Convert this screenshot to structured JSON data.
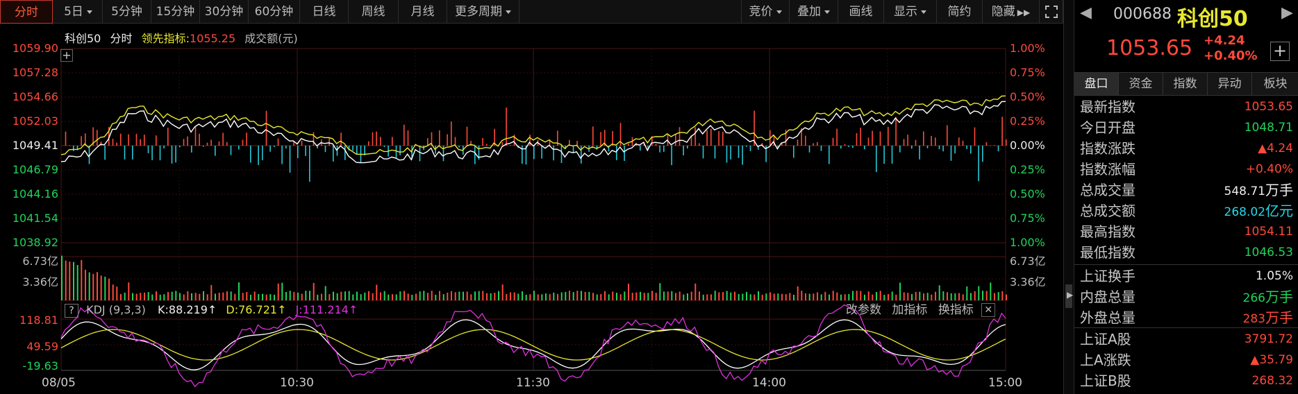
{
  "toolbar": {
    "periods": [
      "分时",
      "5日",
      "5分钟",
      "15分钟",
      "30分钟",
      "60分钟",
      "日线",
      "周线",
      "月线",
      "更多周期"
    ],
    "active_period": "分时",
    "right_buttons": [
      "竞价",
      "叠加",
      "画线",
      "显示",
      "简约",
      "隐藏"
    ]
  },
  "main_legend": {
    "name": "科创50",
    "mode": "分时",
    "leader_label": "领先指标:",
    "leader_value": "1055.25",
    "volume_label": "成交额(元)"
  },
  "price_axis": {
    "left": [
      "1059.90",
      "1057.28",
      "1054.66",
      "1052.03",
      "1049.41",
      "1046.79",
      "1044.16",
      "1041.54",
      "1038.92"
    ],
    "right": [
      "1.00%",
      "0.75%",
      "0.50%",
      "0.25%",
      "0.00%",
      "0.25%",
      "0.50%",
      "0.75%",
      "1.00%"
    ]
  },
  "volume_axis": {
    "left": [
      "6.73亿",
      "3.36亿"
    ],
    "right": [
      "6.73亿",
      "3.36亿"
    ]
  },
  "kdj": {
    "question": "?",
    "title": "KDJ (9,3,3)",
    "k_label": "K:88.219↑",
    "d_label": "D:76.721↑",
    "j_label": "J:111.214↑",
    "axis": [
      "118.81",
      "49.59",
      "-19.63"
    ],
    "actions": [
      "改参数",
      "加指标",
      "换指标"
    ]
  },
  "time_axis": [
    "08/05",
    "10:30",
    "11:30",
    "14:00",
    "15:00"
  ],
  "quote": {
    "code": "000688",
    "name": "科创50",
    "price": "1053.65",
    "change": "+4.24",
    "change_pct": "+0.40%"
  },
  "panel_tabs": [
    "盘口",
    "资金",
    "指数",
    "异动",
    "板块"
  ],
  "panel_active": "盘口",
  "stats": [
    {
      "k": "最新指数",
      "v": "1053.65",
      "c": "red",
      "u": ""
    },
    {
      "k": "今日开盘",
      "v": "1048.71",
      "c": "green",
      "u": ""
    },
    {
      "k": "指数涨跌",
      "v": "▲4.24",
      "c": "red",
      "u": ""
    },
    {
      "k": "指数涨幅",
      "v": "+0.40%",
      "c": "red",
      "u": ""
    },
    {
      "k": "总成交量",
      "v": "548.71",
      "c": "white",
      "u": "万手"
    },
    {
      "k": "总成交额",
      "v": "268.02",
      "c": "cyan",
      "u": "亿元"
    },
    {
      "k": "最高指数",
      "v": "1054.11",
      "c": "red",
      "u": ""
    },
    {
      "k": "最低指数",
      "v": "1046.53",
      "c": "green",
      "u": ""
    },
    {
      "k": "上证换手",
      "v": "1.05%",
      "c": "white",
      "u": ""
    },
    {
      "k": "内盘总量",
      "v": "266",
      "c": "green",
      "u": "万手"
    },
    {
      "k": "外盘总量",
      "v": "283",
      "c": "red",
      "u": "万手"
    },
    {
      "k": "上证A股",
      "v": "3791.72",
      "c": "red",
      "u": ""
    },
    {
      "k": "上A涨跌",
      "v": "▲35.79",
      "c": "red",
      "u": ""
    },
    {
      "k": "上证B股",
      "v": "268.32",
      "c": "red",
      "u": ""
    }
  ],
  "colors": {
    "up": "#ff4a3a",
    "down": "#21d45a",
    "index_line": "#ffffff",
    "leader_line": "#e8e830",
    "k": "#ffffff",
    "d": "#e8e830",
    "j": "#e030e0",
    "bg": "#000000",
    "grid": "#3a1010"
  }
}
